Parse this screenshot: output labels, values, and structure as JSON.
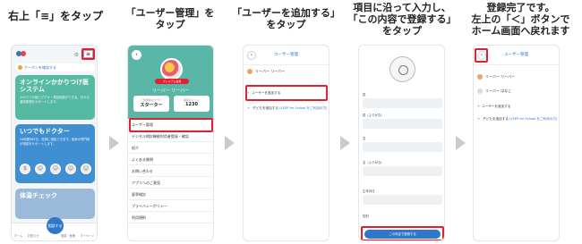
{
  "steps": [
    {
      "title": "右上「≡」をタップ"
    },
    {
      "title": "「ユーザー管理」を\nタップ"
    },
    {
      "title": "「ユーザーを追加する」\nをタップ"
    },
    {
      "title": "項目に沿って入力し、\n「この内容で登録する」\nをタップ"
    },
    {
      "title": "登録完了です。\n左上の「＜」ボタンで\nホーム画面へ戻れます"
    }
  ],
  "screen1": {
    "menu_icon": "≡",
    "coupon": "クーポンを確認する",
    "card1": {
      "title": "オンラインかかりつけ医システム",
      "desc": "かかりつけ医にビデオ・電話相談ができる、日々の健康管理をサポートします。"
    },
    "card2": {
      "title": "いつでもドクター",
      "desc": "24時間365日、医師に相談できます。医療の専門家が相談をサポートします。"
    },
    "card3": {
      "title": "体温チェック"
    },
    "tabs": [
      "ホーム",
      "お知らせ",
      "健康・医療",
      "マイページ"
    ],
    "fab": "相談する"
  },
  "screen2": {
    "badge": "プレミアム会員",
    "user_name": "リーバー リーバー",
    "plan_label": "ご利用中のプラン",
    "plan_value": "スターター",
    "points_label": "保有ポイント",
    "points_value": "1230",
    "menu": [
      "ユーザー管理",
      "デジタル問診機能利用者登録・確認",
      "紹介",
      "よくある質問",
      "お問い合わせ",
      "アプリへのご意見",
      "夏季検診",
      "プライバシーポリシー",
      "利用規約"
    ]
  },
  "screen3": {
    "title": "ユーザー管理",
    "member": "リーバー リーバー",
    "add_user": "ユーザーを追加する",
    "add_child": "子どもを追加する",
    "add_child_link": "(LEEP for School をご利用の方)"
  },
  "screen4": {
    "labels": [
      "姓",
      "姓（ふりがな）",
      "名",
      "名（ふりがな）",
      "生年月日",
      "性別"
    ],
    "submit": "この内容で登録する"
  },
  "screen5": {
    "title": "ユーザー管理",
    "members": [
      "リーバー リーバー",
      "リーバー はなこ"
    ],
    "add_user": "ユーザーを追加する",
    "add_child": "子どもを追加する",
    "add_child_link": "(LEEP for School をご利用の方)"
  },
  "colors": {
    "highlight": "#e5202e",
    "brand_blue": "#2f77c9",
    "teal": "#5ab7a7",
    "arrow": "#c8cbd0"
  }
}
